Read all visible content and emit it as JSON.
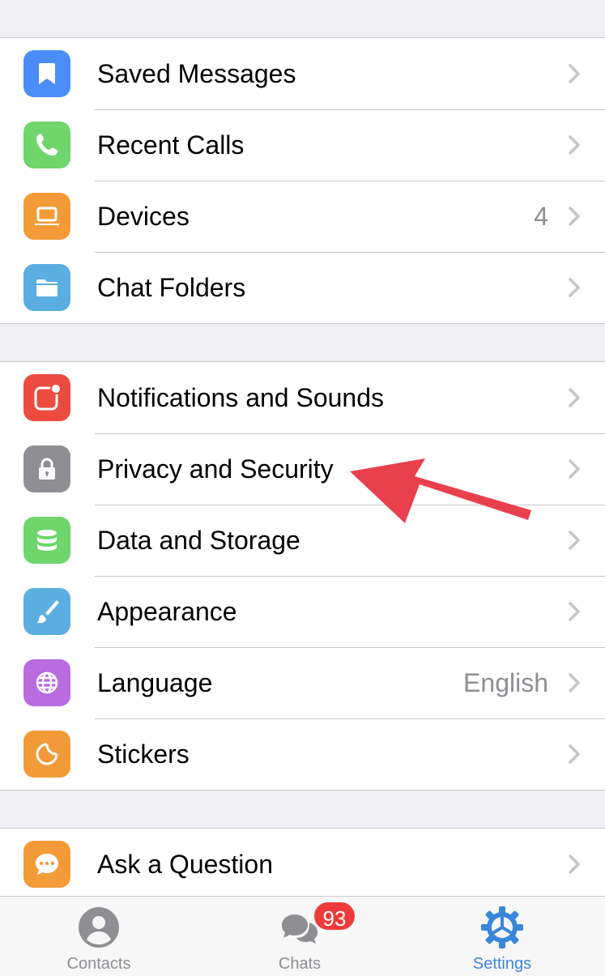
{
  "colors": {
    "accent": "#3a86d8",
    "badge": "#ef3a3a",
    "annotation_arrow": "#e8414d"
  },
  "groups": [
    {
      "items": [
        {
          "label": "Saved Messages",
          "icon": "bookmark-icon",
          "icon_color": "#4a8df7",
          "value": ""
        },
        {
          "label": "Recent Calls",
          "icon": "phone-icon",
          "icon_color": "#6fd56c",
          "value": ""
        },
        {
          "label": "Devices",
          "icon": "laptop-icon",
          "icon_color": "#f29b38",
          "value": "4"
        },
        {
          "label": "Chat Folders",
          "icon": "folder-icon",
          "icon_color": "#5aaee0",
          "value": ""
        }
      ]
    },
    {
      "items": [
        {
          "label": "Notifications and Sounds",
          "icon": "notification-icon",
          "icon_color": "#ec4b3f",
          "value": ""
        },
        {
          "label": "Privacy and Security",
          "icon": "lock-icon",
          "icon_color": "#8e8e93",
          "value": ""
        },
        {
          "label": "Data and Storage",
          "icon": "database-icon",
          "icon_color": "#6fd56c",
          "value": ""
        },
        {
          "label": "Appearance",
          "icon": "brush-icon",
          "icon_color": "#5aaee0",
          "value": ""
        },
        {
          "label": "Language",
          "icon": "globe-icon",
          "icon_color": "#b86ce0",
          "value": "English"
        },
        {
          "label": "Stickers",
          "icon": "sticker-icon",
          "icon_color": "#f29b38",
          "value": ""
        }
      ]
    },
    {
      "items": [
        {
          "label": "Ask a Question",
          "icon": "chat-bubble-icon",
          "icon_color": "#f29b38",
          "value": ""
        }
      ]
    }
  ],
  "tabbar": {
    "tabs": [
      {
        "label": "Contacts",
        "icon": "person-icon",
        "active": false
      },
      {
        "label": "Chats",
        "icon": "chats-icon",
        "active": false,
        "badge": "93"
      },
      {
        "label": "Settings",
        "icon": "gear-icon",
        "active": true
      }
    ]
  }
}
